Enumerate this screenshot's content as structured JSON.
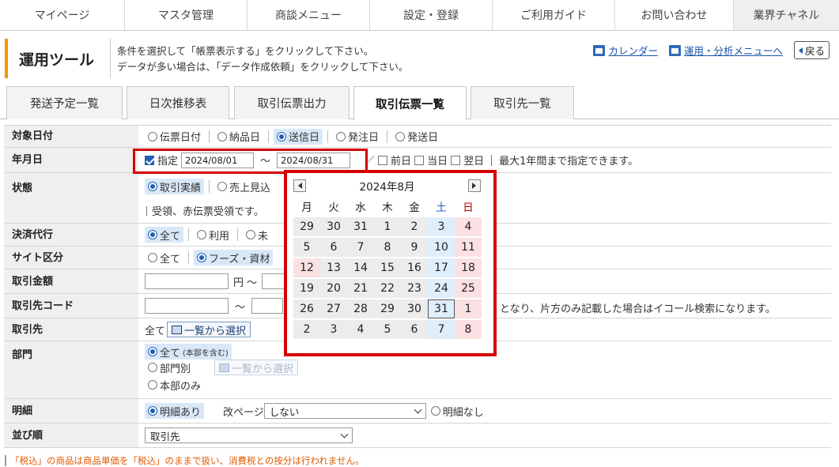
{
  "nav": [
    "マイページ",
    "マスタ管理",
    "商談メニュー",
    "設定・登録",
    "ご利用ガイド",
    "お問い合わせ",
    "業界チャネル"
  ],
  "header": {
    "title": "運用ツール",
    "instr1": "条件を選択して「帳票表示する」をクリックして下さい。",
    "instr2": "データが多い場合は、「データ作成依頼」をクリックして下さい。",
    "calendar_link": "カレンダー",
    "menu_link": "運用・分析メニューへ",
    "back": "戻る"
  },
  "tabs": [
    "発送予定一覧",
    "日次推移表",
    "取引伝票出力",
    "取引伝票一覧",
    "取引先一覧"
  ],
  "form": {
    "target_date": {
      "label": "対象日付",
      "options": [
        "伝票日付",
        "納品日",
        "送信日",
        "発注日",
        "発送日"
      ]
    },
    "ym": {
      "label": "年月日",
      "specify": "指定",
      "from": "2024/08/01",
      "tilde": "〜",
      "to": "2024/08/31",
      "prev": "前日",
      "today": "当日",
      "next": "翌日",
      "note": "最大1年間まで指定できます。"
    },
    "status": {
      "label": "状態",
      "opt1": "取引実績",
      "opt2": "売上見込",
      "note": "受領、赤伝票受領です。"
    },
    "settle": {
      "label": "決済代行",
      "opt1": "全て",
      "opt2": "利用",
      "opt3": "未"
    },
    "site": {
      "label": "サイト区分",
      "opt1": "全て",
      "opt2": "フーズ・資材"
    },
    "amount": {
      "label": "取引金額",
      "unit": "円 〜"
    },
    "code": {
      "label": "取引先コード",
      "tilde": "〜",
      "note": "となり、片方のみ記載した場合はイコール検索になります。"
    },
    "partner": {
      "label": "取引先",
      "all": "全て",
      "btn": "一覧から選択"
    },
    "dept": {
      "label": "部門",
      "opt1": "全て",
      "opt1_note": "(本部を含む)",
      "opt2": "部門別",
      "btn": "一覧から選択",
      "opt3": "本部のみ"
    },
    "detail": {
      "label": "明細",
      "opt1": "明細あり",
      "page_label": "改ページ",
      "page_value": "しない",
      "opt2": "明細なし"
    },
    "sort": {
      "label": "並び順",
      "value": "取引先"
    }
  },
  "calendar": {
    "title": "2024年8月",
    "dow": [
      "月",
      "火",
      "水",
      "木",
      "金",
      "土",
      "日"
    ],
    "weeks": [
      [
        "29",
        "30",
        "31",
        "1",
        "2",
        "3",
        "4"
      ],
      [
        "5",
        "6",
        "7",
        "8",
        "9",
        "10",
        "11"
      ],
      [
        "12",
        "13",
        "14",
        "15",
        "16",
        "17",
        "18"
      ],
      [
        "19",
        "20",
        "21",
        "22",
        "23",
        "24",
        "25"
      ],
      [
        "26",
        "27",
        "28",
        "29",
        "30",
        "31",
        "1"
      ],
      [
        "2",
        "3",
        "4",
        "5",
        "6",
        "7",
        "8"
      ]
    ],
    "selected": "31",
    "holiday_row_index": 2
  },
  "footnote": "「税込」の商品は商品単価を「税込」のままで扱い、消費税との按分は行われません。"
}
